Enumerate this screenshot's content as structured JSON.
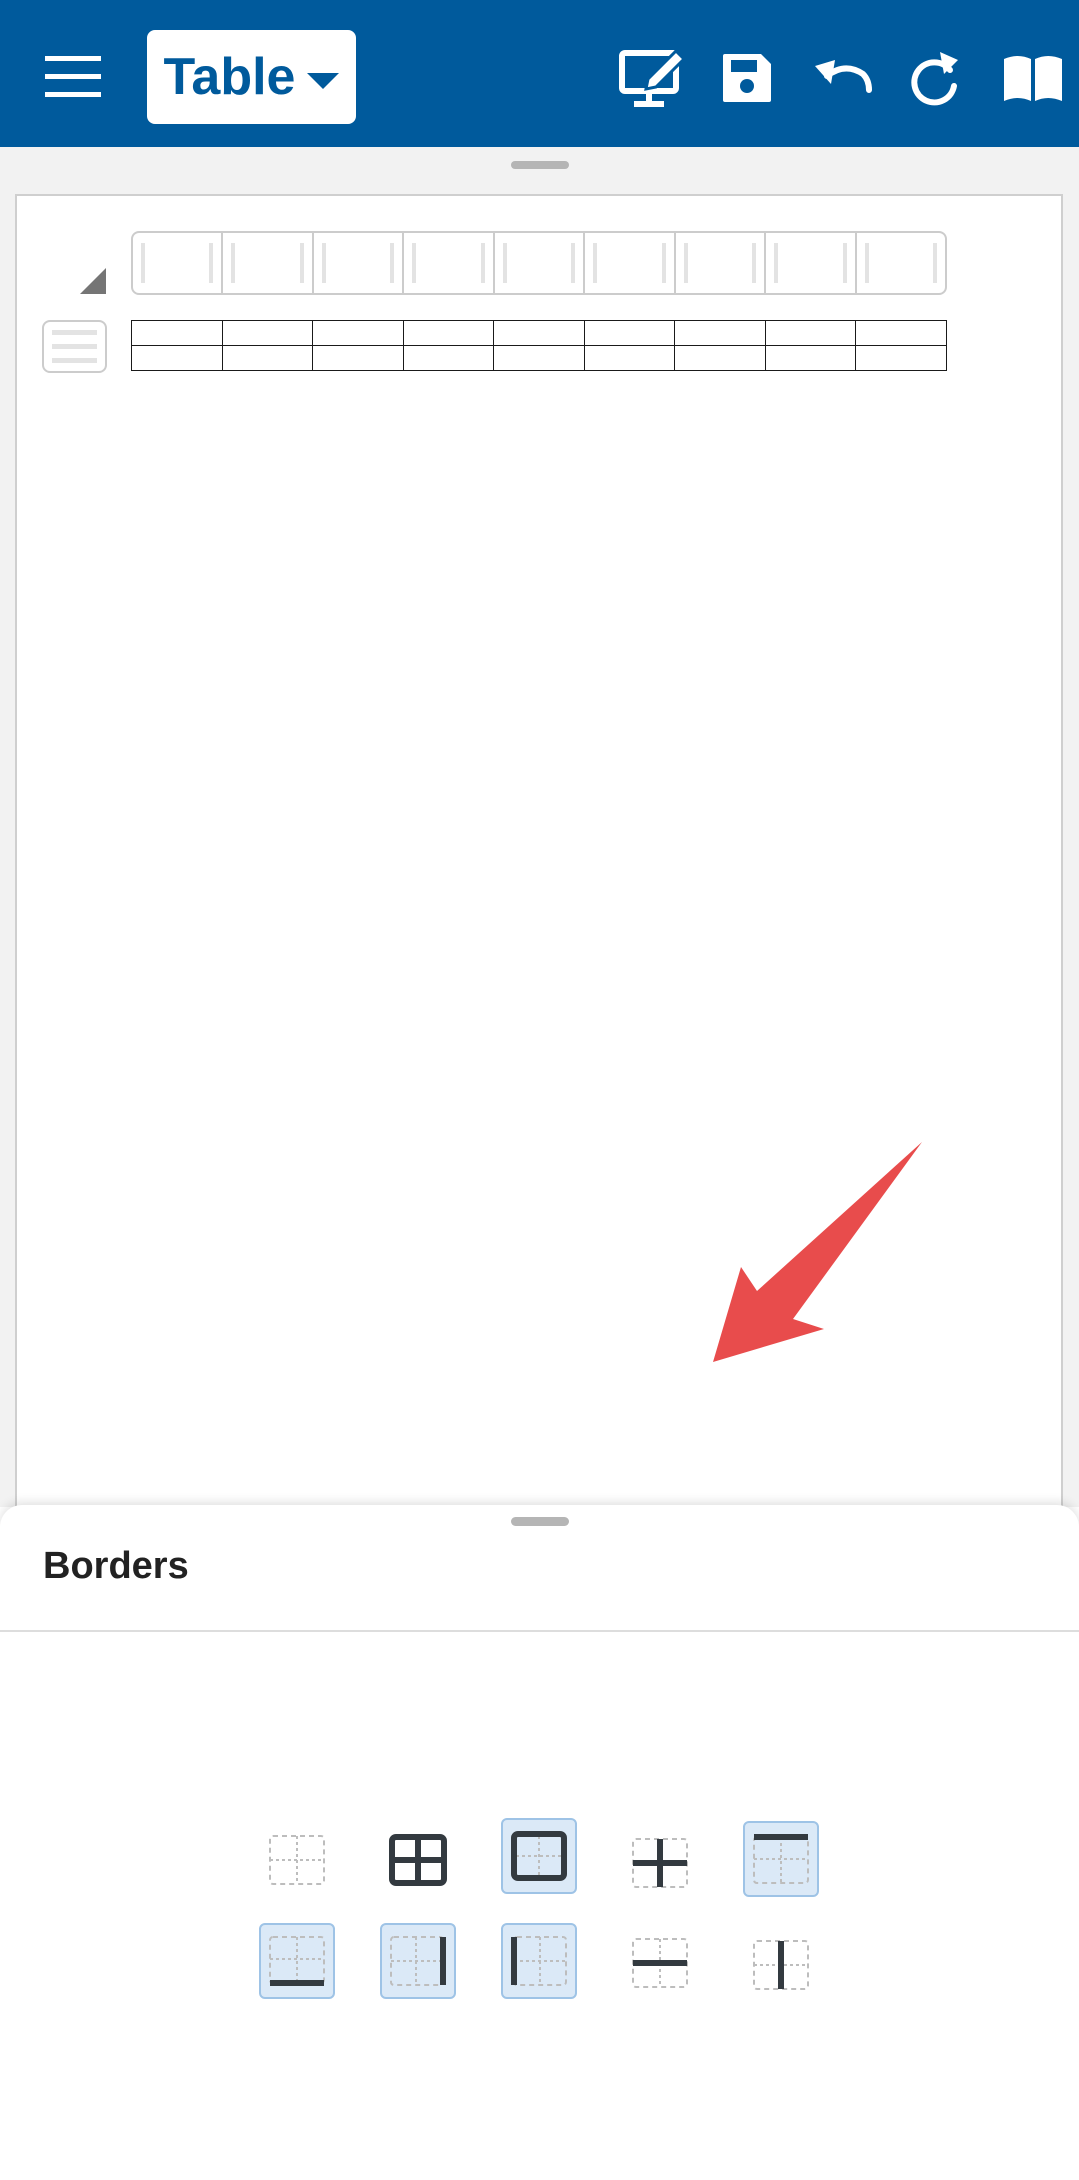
{
  "toolbar": {
    "menu_icon": "hamburger-menu-icon",
    "mode_label": "Table",
    "mode_caret_icon": "caret-down-icon",
    "edit_icon": "monitor-edit-icon",
    "save_icon": "save-icon",
    "undo_icon": "undo-icon",
    "redo_icon": "redo-icon",
    "book_icon": "book-icon",
    "background_color": "#005a9c"
  },
  "document": {
    "table_columns": 9,
    "table_rows": 2
  },
  "annotation": {
    "arrow_color": "#e84c4c"
  },
  "sheet": {
    "title": "Borders",
    "border_options": [
      {
        "id": "no-borders",
        "selected": false
      },
      {
        "id": "all-borders",
        "selected": false
      },
      {
        "id": "outer-borders",
        "selected": true
      },
      {
        "id": "inner-borders",
        "selected": false
      },
      {
        "id": "top-border",
        "selected": true
      },
      {
        "id": "bottom-border",
        "selected": true
      },
      {
        "id": "right-border",
        "selected": true
      },
      {
        "id": "left-border",
        "selected": true
      },
      {
        "id": "inner-horizontal-border",
        "selected": false
      },
      {
        "id": "inner-vertical-border",
        "selected": false
      }
    ]
  }
}
